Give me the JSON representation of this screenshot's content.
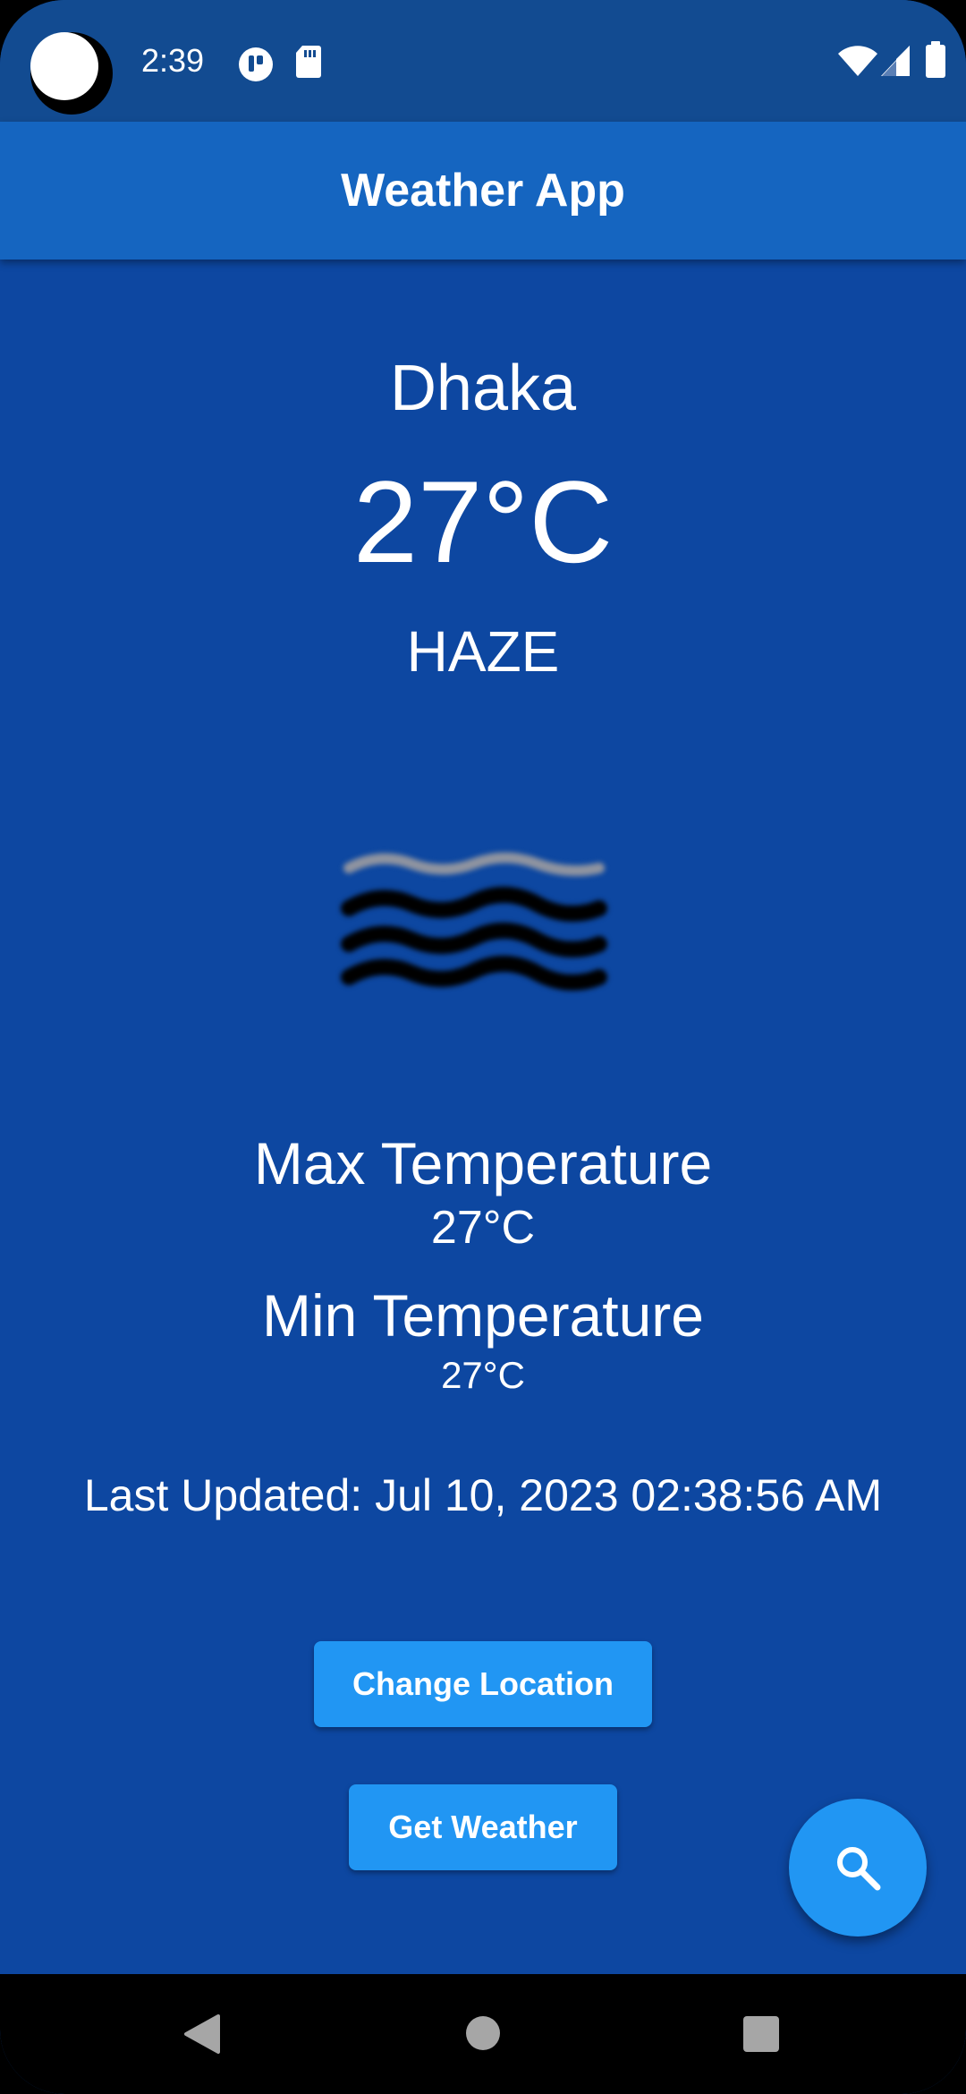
{
  "status_bar": {
    "time": "2:39",
    "icons": [
      "camera-cutout",
      "notification-app-icon",
      "sd-card-icon",
      "wifi-icon",
      "cellular-signal-icon",
      "battery-icon"
    ]
  },
  "app_bar": {
    "title": "Weather App"
  },
  "weather": {
    "city": "Dhaka",
    "temperature": "27°C",
    "condition": "HAZE",
    "icon": "haze-icon"
  },
  "details": {
    "max_label": "Max Temperature",
    "max_value": "27°C",
    "min_label": "Min Temperature",
    "min_value": "27°C",
    "last_updated_label": "Last Updated:",
    "last_updated_value": "Jul 10, 2023 02:38:56 AM"
  },
  "actions": {
    "change_location": "Change Location",
    "get_weather": "Get Weather",
    "fab_icon": "search-icon"
  },
  "nav_bar": {
    "icons": [
      "back-icon",
      "home-icon",
      "recents-icon"
    ]
  },
  "colors": {
    "status_bar": "#124b91",
    "app_bar": "#1565c0",
    "background": "#0d47a1",
    "accent": "#2196f3",
    "text": "#ffffff"
  }
}
